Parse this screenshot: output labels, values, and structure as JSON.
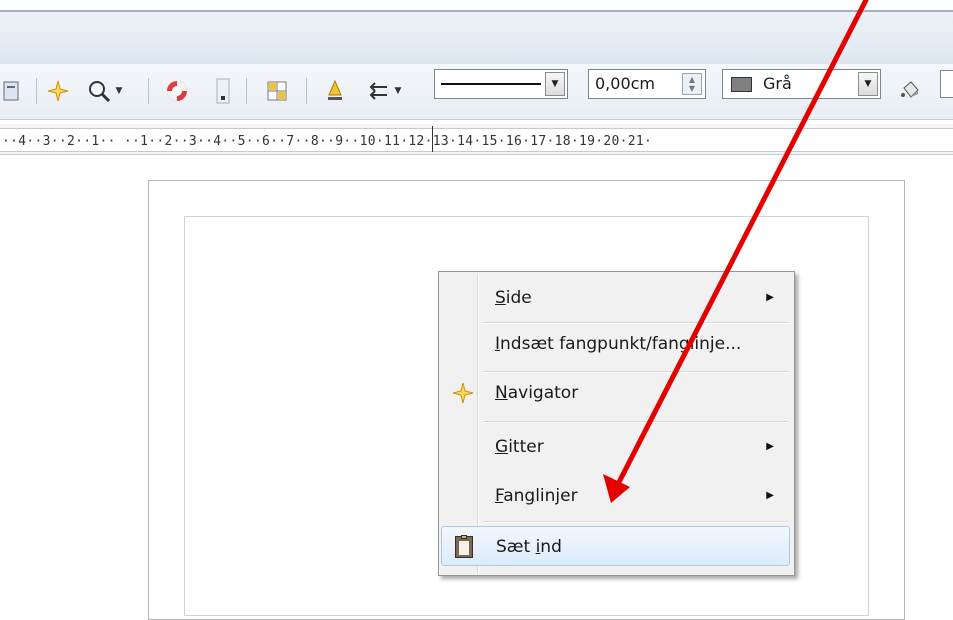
{
  "toolbar": {
    "line_style_label": "",
    "line_width_value": "0,00cm",
    "line_color_label": "Grå",
    "line_color_hex": "#808080"
  },
  "ruler": {
    "text": "··4··3··2··1··  ··1··2··3··4··5··6··7··8··9··10·11·12·13·14·15·16·17·18·19·20·21·"
  },
  "context_menu": {
    "items": [
      {
        "label_pre": "",
        "label_ul": "S",
        "label_post": "ide",
        "has_submenu": true
      },
      {
        "label_pre": "",
        "label_ul": "I",
        "label_post": "ndsæt fangpunkt/fanglinje...",
        "has_submenu": false
      },
      {
        "label_pre": "",
        "label_ul": "N",
        "label_post": "avigator",
        "has_submenu": false,
        "icon": "navigator-star-icon"
      },
      {
        "label_pre": "",
        "label_ul": "G",
        "label_post": "itter",
        "has_submenu": true
      },
      {
        "label_pre": "",
        "label_ul": "F",
        "label_post": "anglinjer",
        "has_submenu": true
      },
      {
        "label_pre": "Sæt ",
        "label_ul": "i",
        "label_post": "nd",
        "has_submenu": false,
        "icon": "paste-clipboard-icon",
        "highlighted": true
      }
    ]
  },
  "colors": {
    "accent_hover": "#dcebfb",
    "annotation_arrow": "#e50000"
  }
}
